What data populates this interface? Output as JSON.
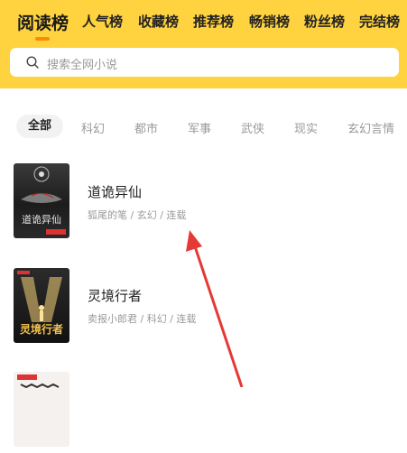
{
  "rank_tabs": [
    {
      "label": "阅读榜",
      "active": true
    },
    {
      "label": "人气榜",
      "active": false
    },
    {
      "label": "收藏榜",
      "active": false
    },
    {
      "label": "推荐榜",
      "active": false
    },
    {
      "label": "畅销榜",
      "active": false
    },
    {
      "label": "粉丝榜",
      "active": false
    },
    {
      "label": "完结榜",
      "active": false
    }
  ],
  "search": {
    "placeholder": "搜索全网小说",
    "icon": "search-icon"
  },
  "categories": [
    {
      "label": "全部",
      "active": true
    },
    {
      "label": "科幻",
      "active": false
    },
    {
      "label": "都市",
      "active": false
    },
    {
      "label": "军事",
      "active": false
    },
    {
      "label": "武侠",
      "active": false
    },
    {
      "label": "现实",
      "active": false
    },
    {
      "label": "玄幻言情",
      "active": false
    }
  ],
  "books": [
    {
      "title": "道诡异仙",
      "meta": "狐尾的笔 / 玄幻 / 连载",
      "cover_text": "道诡异仙"
    },
    {
      "title": "灵境行者",
      "meta": "卖报小郎君 / 科幻 / 连载",
      "cover_text": "灵境行者"
    },
    {
      "title": "",
      "meta": "",
      "cover_text": ""
    }
  ],
  "colors": {
    "header_bg": "#FFD23F",
    "accent": "#FF8A00",
    "annotation_arrow": "#E53935"
  }
}
